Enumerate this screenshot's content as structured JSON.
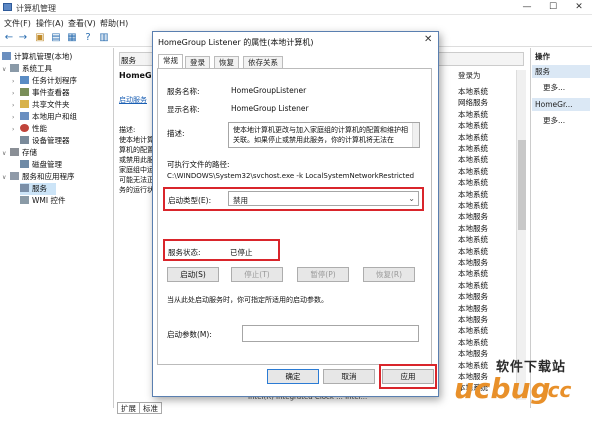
{
  "window": {
    "title": "计算机管理",
    "min": "—",
    "max": "☐",
    "close": "✕"
  },
  "menu": [
    "文件(F)",
    "操作(A)",
    "查看(V)",
    "帮助(H)"
  ],
  "tree": {
    "items": [
      {
        "label": "计算机管理(本地)",
        "arrow": "",
        "indent": 0
      },
      {
        "label": "系统工具",
        "arrow": "∨",
        "indent": 1
      },
      {
        "label": "任务计划程序",
        "arrow": "›",
        "indent": 2
      },
      {
        "label": "事件查看器",
        "arrow": "›",
        "indent": 2
      },
      {
        "label": "共享文件夹",
        "arrow": "›",
        "indent": 2
      },
      {
        "label": "本地用户和组",
        "arrow": "›",
        "indent": 2
      },
      {
        "label": "性能",
        "arrow": "›",
        "indent": 2
      },
      {
        "label": "设备管理器",
        "arrow": "",
        "indent": 2
      },
      {
        "label": "存储",
        "arrow": "∨",
        "indent": 1
      },
      {
        "label": "磁盘管理",
        "arrow": "",
        "indent": 2
      },
      {
        "label": "服务和应用程序",
        "arrow": "∨",
        "indent": 1
      },
      {
        "label": "服务",
        "arrow": "",
        "indent": 2
      },
      {
        "label": "WMI 控件",
        "arrow": "",
        "indent": 2
      }
    ]
  },
  "middle": {
    "tab_label": "服务",
    "heading": "HomeG",
    "link": "启动服务",
    "desc_lines": [
      "描述:",
      "使本地计算",
      "算机的配置",
      "或禁用此服",
      "家庭组中运",
      "可能无法正",
      "务的运行状"
    ],
    "col_header": "登录为",
    "rows": [
      "本地系统",
      "网络服务",
      "本地系统",
      "本地系统",
      "本地系统",
      "本地系统",
      "本地系统",
      "本地系统",
      "本地系统",
      "本地系统",
      "本地系统",
      "本地服务",
      "本地服务",
      "本地系统",
      "本地系统",
      "本地服务",
      "本地系统",
      "本地系统",
      "本地服务",
      "本地服务",
      "本地服务",
      "本地系统",
      "本地系统",
      "本地服务",
      "本地系统",
      "本地服务",
      "本地系统"
    ],
    "bottom_row_text": "Intel(R) Integrated Clock ... Intel..."
  },
  "bottom_tabs": [
    "扩展",
    "标准"
  ],
  "actions": {
    "header": "操作",
    "section1": "服务",
    "more1": "更多...",
    "section2": "HomeGr...",
    "more2": "更多..."
  },
  "dialog": {
    "title": "HomeGroup Listener 的属性(本地计算机)",
    "tabs": [
      "常规",
      "登录",
      "恢复",
      "依存关系"
    ],
    "service_name_label": "服务名称:",
    "service_name": "HomeGroupListener",
    "display_name_label": "显示名称:",
    "display_name": "HomeGroup Listener",
    "description_label": "描述:",
    "description": "使本地计算机更改与加入家庭组的计算机的配置和维护相关联。如果停止或禁用此服务，你的计算机将无法在",
    "exec_path_label": "可执行文件的路径:",
    "exec_path": "C:\\WINDOWS\\System32\\svchost.exe -k LocalSystemNetworkRestricted",
    "startup_type_label": "启动类型(E):",
    "startup_type": "禁用",
    "status_label": "服务状态:",
    "status": "已停止",
    "buttons": [
      "启动(S)",
      "停止(T)",
      "暂停(P)",
      "恢复(R)"
    ],
    "hint": "当从此处启动服务时，你可指定所适用的启动参数。",
    "param_label": "启动参数(M):",
    "ok": "确定",
    "cancel": "取消",
    "apply": "应用",
    "highlight_color": "#d9252b"
  },
  "watermark": {
    "top": "软件下载站",
    "logo": "ucbug",
    "cc": ".cc"
  }
}
